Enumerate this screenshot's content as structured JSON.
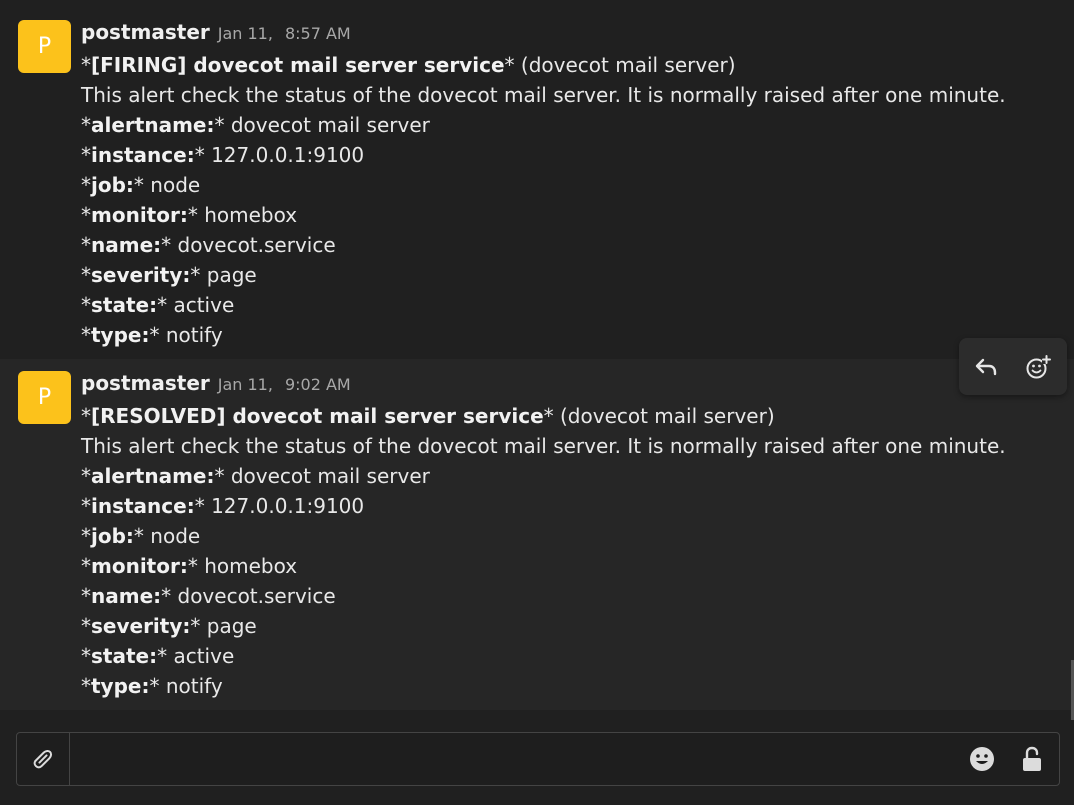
{
  "messages": [
    {
      "avatar_letter": "P",
      "sender": "postmaster",
      "date": "Jan 11,",
      "time": "8:57 AM",
      "title": {
        "prefix": "*",
        "bold": "[FIRING] dovecot mail server service",
        "suffix": "* (dovecot mail server)"
      },
      "description": "This alert check the status of the dovecot mail server. It is normally raised after one minute.",
      "fields": [
        {
          "key": "alertname:",
          "value": "* dovecot mail server"
        },
        {
          "key": "instance:",
          "value": "* 127.0.0.1:9100"
        },
        {
          "key": "job:",
          "value": "* node"
        },
        {
          "key": "monitor:",
          "value": "* homebox"
        },
        {
          "key": "name:",
          "value": "* dovecot.service"
        },
        {
          "key": "severity:",
          "value": "* page"
        },
        {
          "key": "state:",
          "value": "* active"
        },
        {
          "key": "type:",
          "value": "* notify"
        }
      ]
    },
    {
      "avatar_letter": "P",
      "sender": "postmaster",
      "date": "Jan 11,",
      "time": "9:02 AM",
      "title": {
        "prefix": "*",
        "bold": "[RESOLVED] dovecot mail server service",
        "suffix": "* (dovecot mail server)"
      },
      "description": "This alert check the status of the dovecot mail server. It is normally raised after one minute.",
      "fields": [
        {
          "key": "alertname:",
          "value": "* dovecot mail server"
        },
        {
          "key": "instance:",
          "value": "* 127.0.0.1:9100"
        },
        {
          "key": "job:",
          "value": "* node"
        },
        {
          "key": "monitor:",
          "value": "* homebox"
        },
        {
          "key": "name:",
          "value": "* dovecot.service"
        },
        {
          "key": "severity:",
          "value": "* page"
        },
        {
          "key": "state:",
          "value": "* active"
        },
        {
          "key": "type:",
          "value": "* notify"
        }
      ]
    }
  ],
  "hover_actions": {
    "reply_icon": "reply-icon",
    "react_icon": "add-reaction-icon"
  },
  "composer": {
    "value": "",
    "placeholder": "",
    "attach_icon": "paperclip-icon",
    "emoji_icon": "emoji-icon",
    "lock_icon": "unlocked-padlock-icon"
  },
  "colors": {
    "background": "#202020",
    "hover_row": "#262626",
    "avatar": "#fcc21b",
    "text": "#e8e8e8",
    "muted": "#a8a8a8"
  }
}
